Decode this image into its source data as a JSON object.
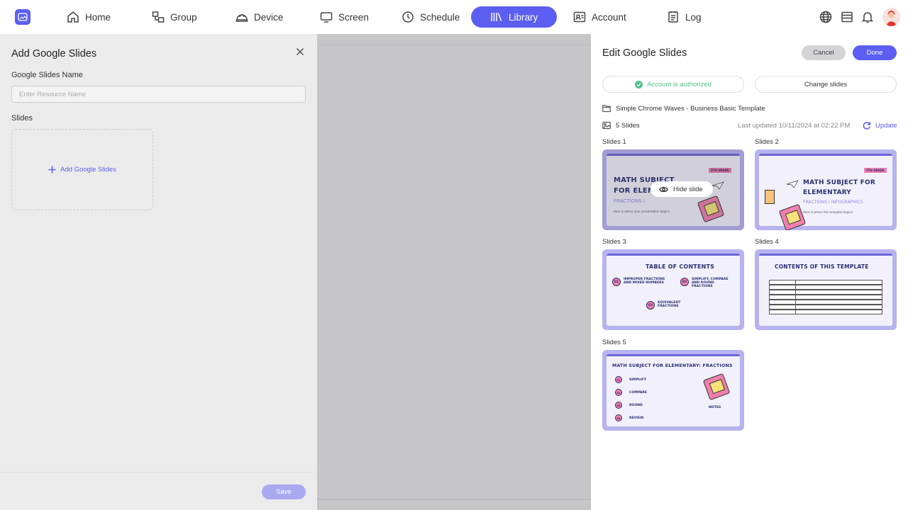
{
  "nav": {
    "items": [
      {
        "label": "Home",
        "icon": "home-icon"
      },
      {
        "label": "Group",
        "icon": "group-icon"
      },
      {
        "label": "Device",
        "icon": "device-icon"
      },
      {
        "label": "Screen",
        "icon": "screen-icon"
      },
      {
        "label": "Schedule",
        "icon": "clock-icon"
      },
      {
        "label": "Library",
        "icon": "library-icon",
        "active": true
      },
      {
        "label": "Account",
        "icon": "account-icon"
      },
      {
        "label": "Log",
        "icon": "log-icon"
      }
    ],
    "right_icons": [
      "globe-icon",
      "wallet-icon",
      "bell-icon",
      "avatar"
    ]
  },
  "add_panel": {
    "title": "Add Google Slides",
    "name_label": "Google Slides Name",
    "name_placeholder": "Enter Resource Name",
    "name_value": "",
    "slides_label": "Slides",
    "add_label": "Add Google Slides",
    "save_label": "Save"
  },
  "edit_panel": {
    "title": "Edit Google Slides",
    "cancel_label": "Cancel",
    "done_label": "Done",
    "auth_status": "Account is authorized",
    "change_label": "Change slides",
    "presentation_name": "Simple Chrome Waves - Business Basic Template",
    "slide_count": "5 Slides",
    "last_updated": "Last updated 10/11/2024 at 02:22 PM",
    "update_label": "Update",
    "hide_slide_label": "Hide slide",
    "slides": [
      {
        "label": "Slides 1",
        "title_line1": "MATH SUBJECT",
        "title_line2": "FOR ELEMENTARY",
        "subtitle": "FRACTIONS I",
        "badge": "5TH GRADE",
        "note": "Here is where your presentation begins"
      },
      {
        "label": "Slides 2",
        "title_line1": "MATH SUBJECT FOR",
        "title_line2": "ELEMENTARY",
        "subtitle": "FRACTIONS I INFOGRAPHICS",
        "badge": "5TH GRADE",
        "note": "Here is where this template begins"
      },
      {
        "label": "Slides 3",
        "title": "TABLE OF CONTENTS",
        "items": [
          {
            "num": "01",
            "text": "IMPROPER FRACTIONS AND MIXED NUMBERS"
          },
          {
            "num": "02",
            "text": "SIMPLIFY, COMPARE AND ROUND FRACTIONS"
          },
          {
            "num": "03",
            "text": "EQUIVALENT FRACTIONS"
          }
        ]
      },
      {
        "label": "Slides 4",
        "title": "CONTENTS OF THIS TEMPLATE"
      },
      {
        "label": "Slides 5",
        "title": "MATH SUBJECT FOR ELEMENTARY: FRACTIONS",
        "items": [
          {
            "num": "01",
            "text": "SIMPLIFY"
          },
          {
            "num": "02",
            "text": "COMPARE"
          },
          {
            "num": "03",
            "text": "ROUND"
          },
          {
            "num": "04",
            "text": "REVIEW"
          }
        ],
        "notes": "NOTES"
      }
    ]
  },
  "colors": {
    "accent": "#5b5ef0",
    "success": "#52c08b",
    "slide_frame": "#b7b3ef",
    "slide_title": "#2a2f72"
  }
}
